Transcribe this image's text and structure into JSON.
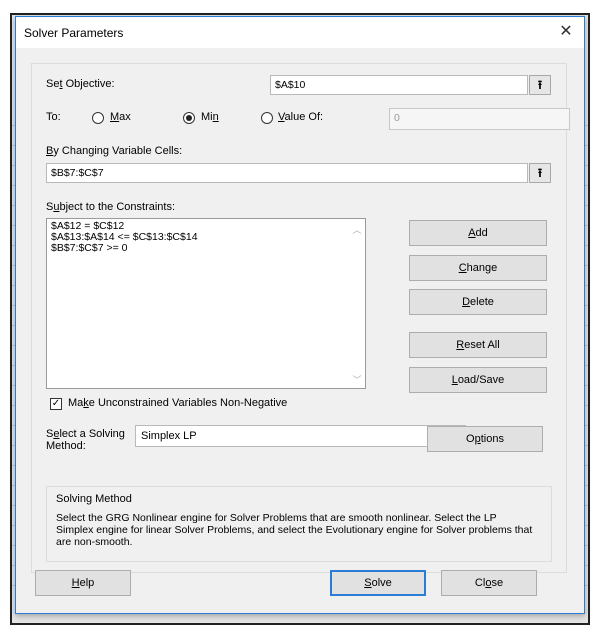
{
  "dialog": {
    "title": "Solver Parameters",
    "close_icon": "close-icon"
  },
  "objective": {
    "label_pre": "Se",
    "label_acc": "t",
    "label_post": " Objective:",
    "value": "$A$10",
    "ref_icon": "collapse-dialog-icon"
  },
  "to": {
    "label": "To:",
    "options": [
      {
        "pre": "",
        "acc": "M",
        "post": "ax",
        "selected": false
      },
      {
        "pre": "Mi",
        "acc": "n",
        "post": "",
        "selected": true
      },
      {
        "pre": "",
        "acc": "V",
        "post": "alue Of:",
        "selected": false
      }
    ],
    "value_of": "0"
  },
  "changing": {
    "label_acc": "B",
    "label_post": "y Changing Variable Cells:",
    "value": "$B$7:$C$7"
  },
  "constraints": {
    "label_pre": "S",
    "label_acc": "u",
    "label_post": "bject to the Constraints:",
    "items": [
      "$A$12 = $C$12",
      "$A$13:$A$14 <= $C$13:$C$14",
      "$B$7:$C$7 >= 0"
    ]
  },
  "side_buttons": {
    "add": {
      "pre": "",
      "acc": "A",
      "post": "dd"
    },
    "change": {
      "pre": "",
      "acc": "C",
      "post": "hange"
    },
    "delete": {
      "pre": "",
      "acc": "D",
      "post": "elete"
    },
    "reset": {
      "pre": "",
      "acc": "R",
      "post": "eset All"
    },
    "loadsave": {
      "pre": "",
      "acc": "L",
      "post": "oad/Save"
    }
  },
  "nonneg": {
    "checked": true,
    "pre": "Ma",
    "acc": "k",
    "post": "e Unconstrained Variables Non-Negative"
  },
  "method": {
    "label_pre": "S",
    "label_acc": "e",
    "label_post": "lect a Solving",
    "label_line2": "Method:",
    "selected": "Simplex LP",
    "options_btn": {
      "pre": "O",
      "acc": "p",
      "post": "tions"
    }
  },
  "info": {
    "heading": "Solving Method",
    "text": "Select the GRG Nonlinear engine for Solver Problems that are smooth nonlinear. Select the LP Simplex engine for linear Solver Problems, and select the Evolutionary engine for Solver problems that are non-smooth."
  },
  "footer": {
    "help": {
      "pre": "",
      "acc": "H",
      "post": "elp"
    },
    "solve": {
      "pre": "",
      "acc": "S",
      "post": "olve"
    },
    "close": {
      "pre": "Cl",
      "acc": "o",
      "post": "se"
    }
  }
}
